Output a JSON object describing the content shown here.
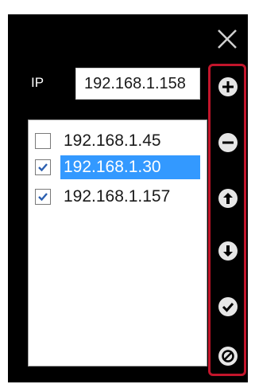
{
  "dialog": {
    "close_icon": "close-icon",
    "ip_label": "IP",
    "ip_value": "192.168.1.158",
    "list": [
      {
        "label": "192.168.1.45",
        "checked": false,
        "selected": false
      },
      {
        "label": "192.168.1.30",
        "checked": true,
        "selected": true
      },
      {
        "label": "192.168.1.157",
        "checked": true,
        "selected": false
      }
    ],
    "toolbar": [
      "add-icon",
      "remove-icon",
      "move-up-icon",
      "move-down-icon",
      "confirm-icon",
      "cancel-icon"
    ]
  },
  "colors": {
    "background": "#000000",
    "selection": "#3399ff",
    "highlight_border": "#c2152b",
    "icon": "#e6e6e6"
  }
}
